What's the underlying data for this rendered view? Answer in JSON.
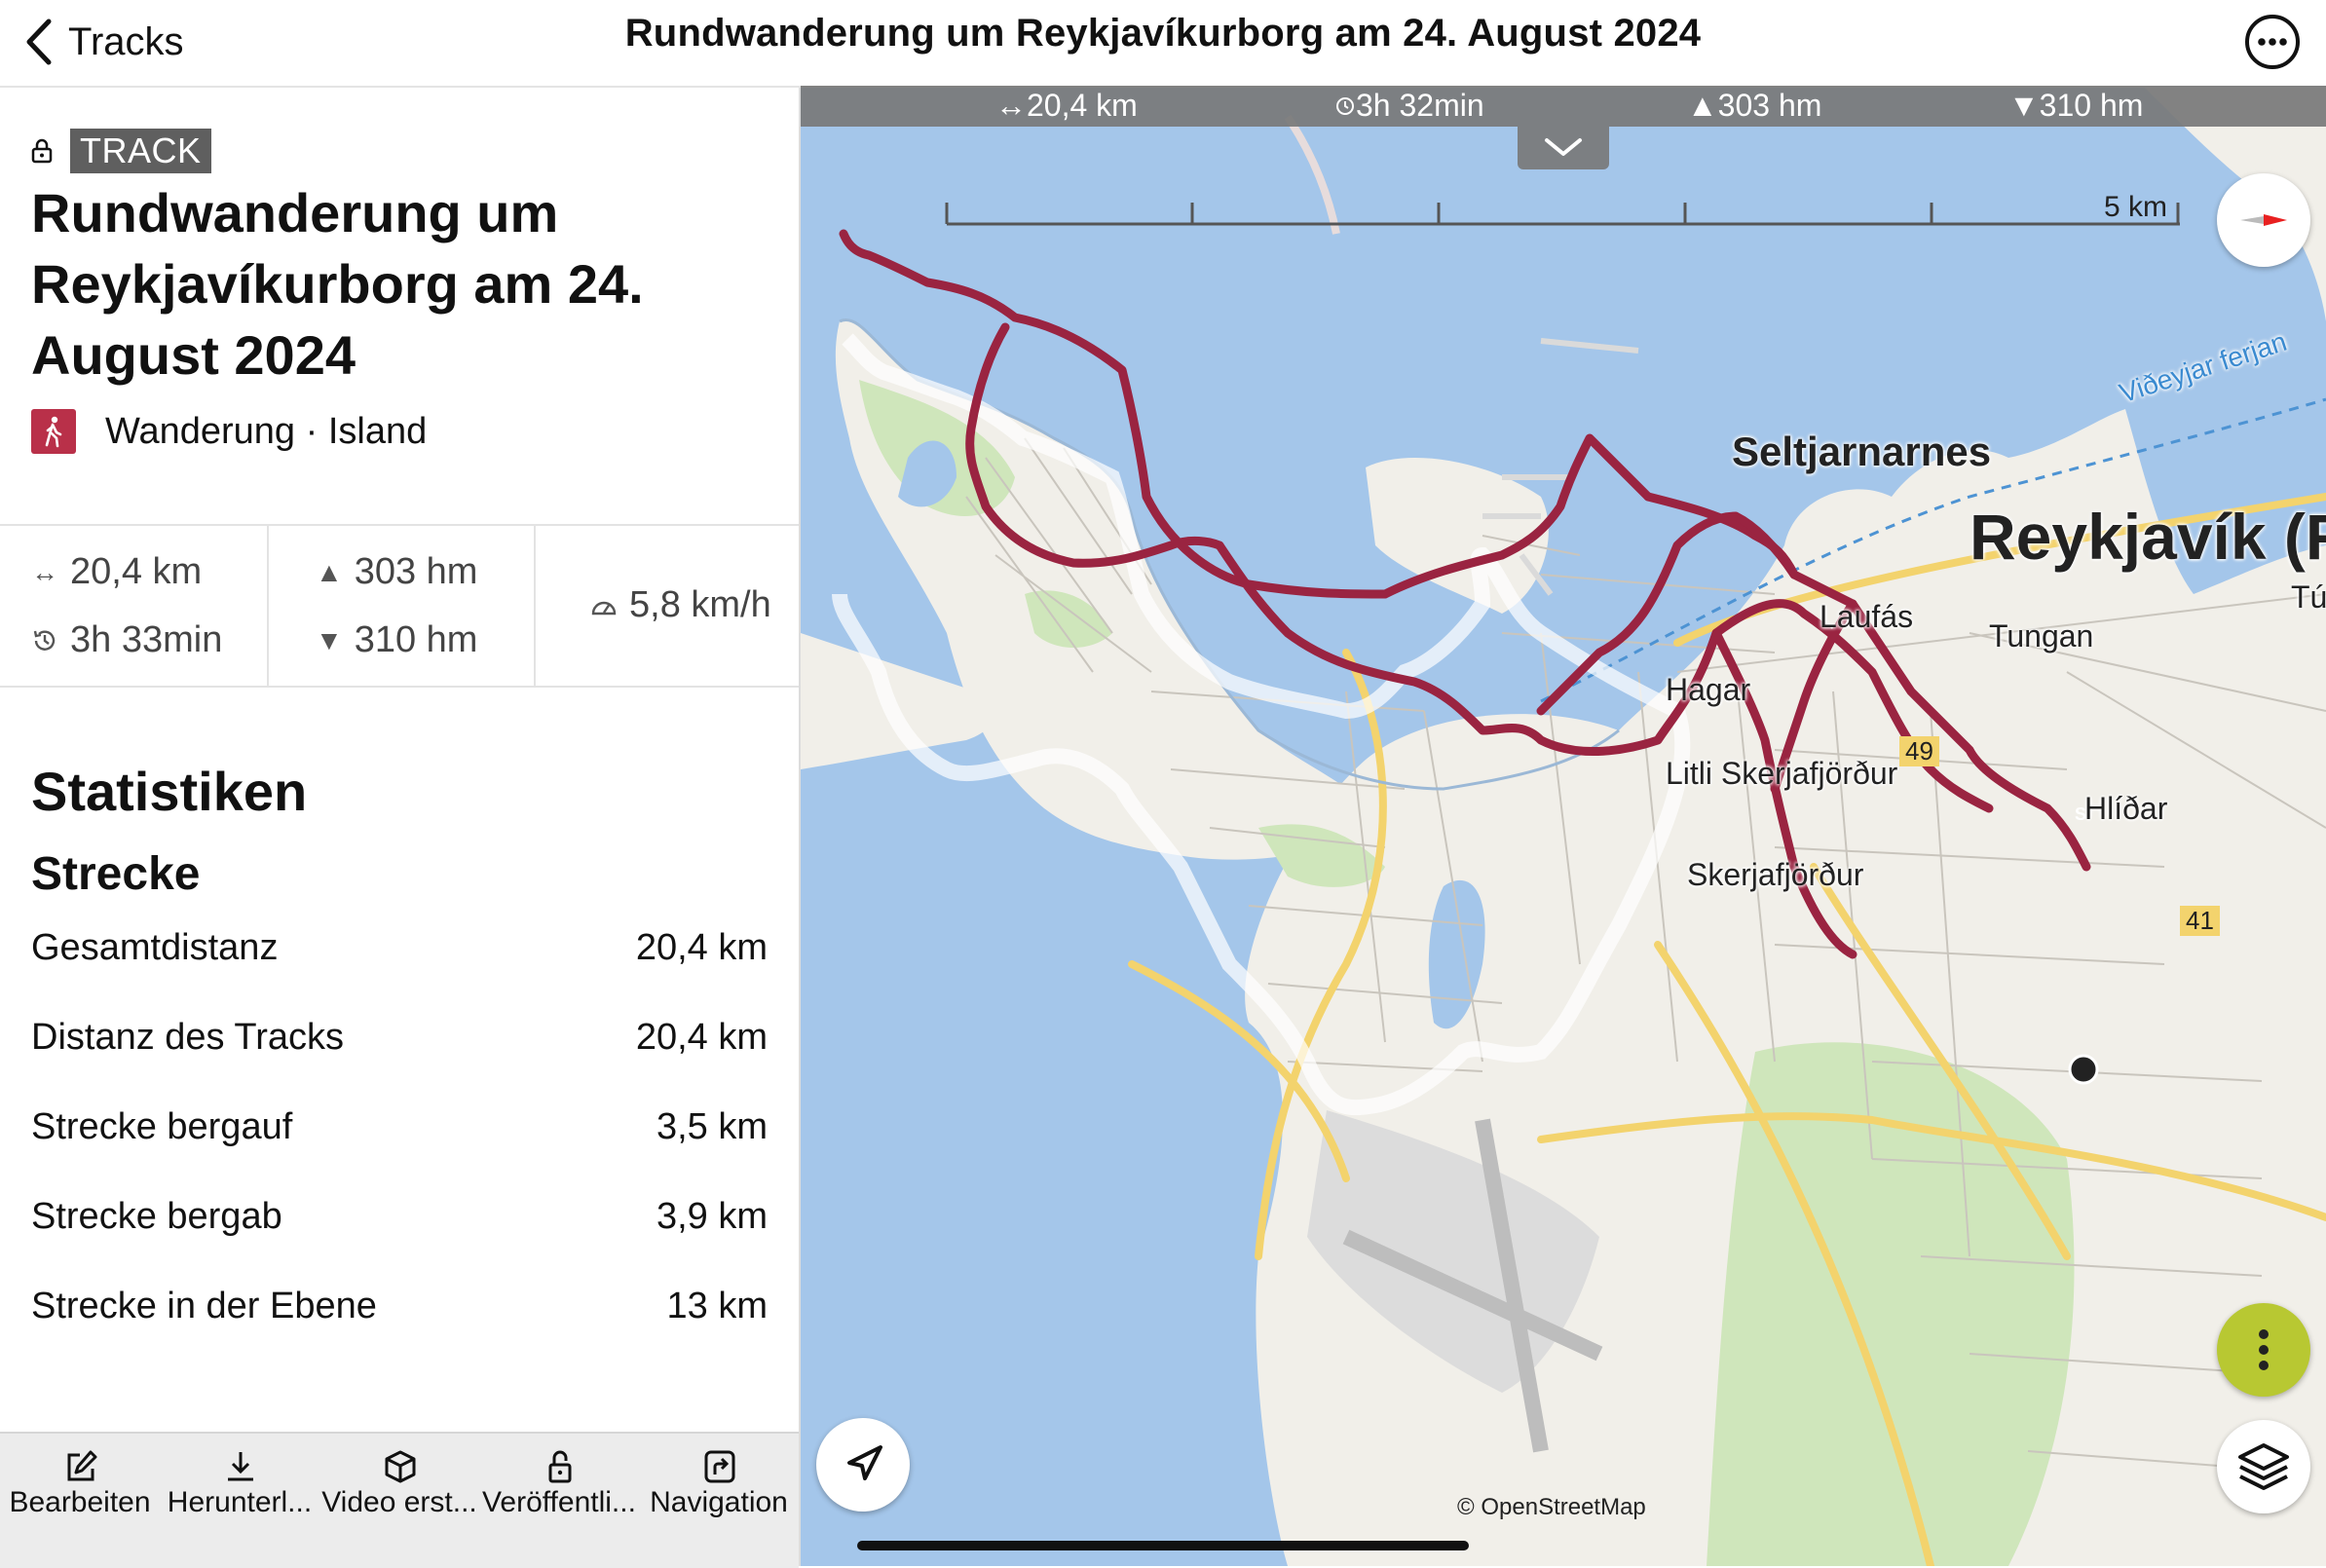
{
  "nav": {
    "back_label": "Tracks",
    "title": "Rundwanderung um Reykjavíkurborg am 24. August 2024"
  },
  "track": {
    "badge": "TRACK",
    "title": "Rundwanderung um Reykjavíkurborg am 24. August 2024",
    "activity": "Wanderung · Island",
    "accent_color": "#b93049"
  },
  "summary": {
    "distance": "20,4 km",
    "duration": "3h 33min",
    "ascent": "303 hm",
    "descent": "310 hm",
    "speed": "5,8 km/h"
  },
  "statistics": {
    "heading": "Statistiken",
    "section": "Strecke",
    "rows": [
      {
        "label": "Gesamtdistanz",
        "value": "20,4 km"
      },
      {
        "label": "Distanz des Tracks",
        "value": "20,4 km"
      },
      {
        "label": "Strecke bergauf",
        "value": "3,5 km"
      },
      {
        "label": "Strecke bergab",
        "value": "3,9 km"
      },
      {
        "label": "Strecke in der Ebene",
        "value": "13 km"
      }
    ]
  },
  "toolbar": {
    "items": [
      {
        "label": "Bearbeiten",
        "icon": "edit-icon"
      },
      {
        "label": "Herunterl...",
        "icon": "download-icon"
      },
      {
        "label": "Video erst...",
        "icon": "cube-icon"
      },
      {
        "label": "Veröffentli...",
        "icon": "lock-open-icon"
      },
      {
        "label": "Navigation",
        "icon": "navigation-icon"
      }
    ]
  },
  "map": {
    "stats": {
      "distance": "↔20,4 km",
      "duration": "3h 32min",
      "ascent": "303 hm",
      "descent": "310 hm"
    },
    "scale_label": "5 km",
    "attribution": "© OpenStreetMap",
    "labels": {
      "seltjarnarnes": "Seltjarnarnes",
      "reykjavik": "Reykjavík (Reykjavik)",
      "laufas": "Laufás",
      "tungan": "Tungan",
      "tun": "Tún",
      "hagar": "Hagar",
      "litli": "Litli Skerjafjörður",
      "skerjafjordur": "Skerjafjörður",
      "hlidar": "Hlíðar",
      "ferry": "Viðeyjar ferjan",
      "road49": "49",
      "road41": "41",
      "start_marker": "S"
    },
    "colors": {
      "water": "#a4c6ea",
      "land": "#f1efe9",
      "track": "#9a2441",
      "park": "#cfe6bb"
    }
  }
}
